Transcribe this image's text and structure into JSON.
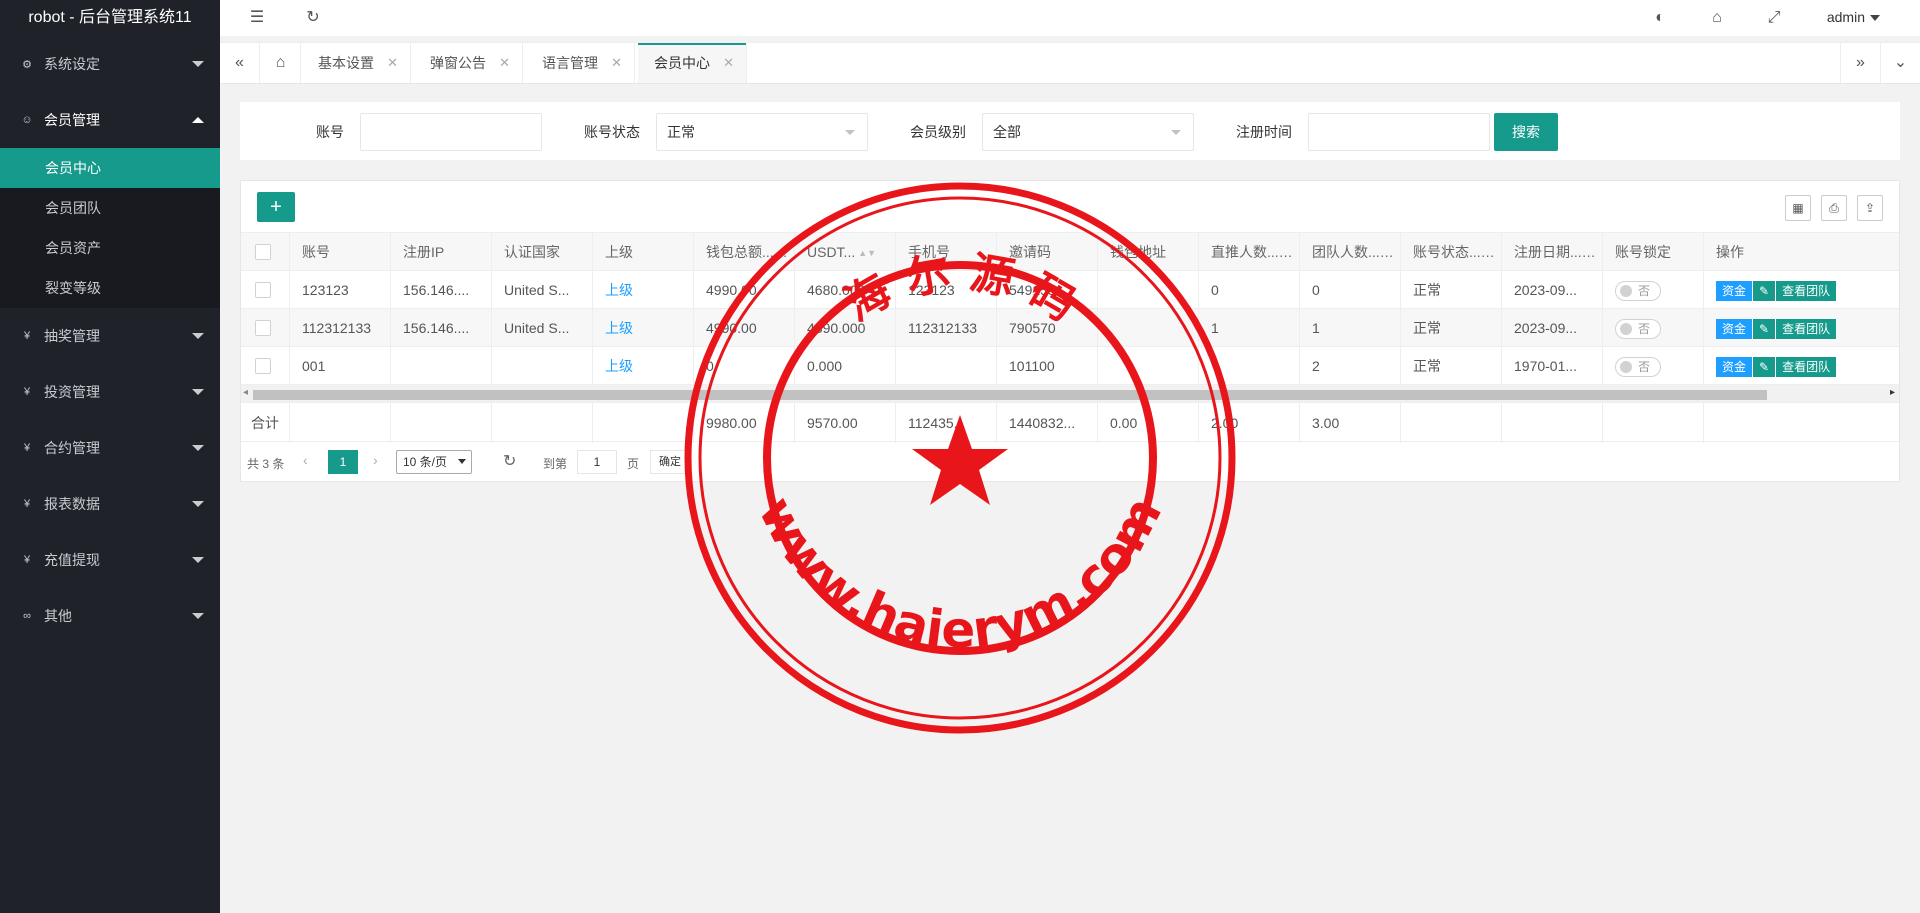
{
  "app": {
    "title": "robot - 后台管理系统11"
  },
  "sidebar": {
    "groups": [
      {
        "label": "系统设定",
        "icon": "gear-icon"
      },
      {
        "label": "会员管理",
        "icon": "user-icon",
        "items": [
          "会员中心",
          "会员团队",
          "会员资产",
          "裂变等级"
        ]
      },
      {
        "label": "抽奖管理",
        "icon": "yen-icon"
      },
      {
        "label": "投资管理",
        "icon": "yen-icon"
      },
      {
        "label": "合约管理",
        "icon": "yen-icon"
      },
      {
        "label": "报表数据",
        "icon": "yen-icon"
      },
      {
        "label": "充值提现",
        "icon": "yen-icon"
      },
      {
        "label": "其他",
        "icon": "link-icon"
      }
    ],
    "active_item": "会员中心"
  },
  "header": {
    "user": "admin"
  },
  "tabs": [
    "基本设置",
    "弹窗公告",
    "语言管理",
    "会员中心"
  ],
  "search": {
    "account_label": "账号",
    "account_value": "",
    "status_label": "账号状态",
    "status_value": "正常",
    "level_label": "会员级别",
    "level_value": "全部",
    "regtime_label": "注册时间",
    "regtime_value": "",
    "button": "搜索"
  },
  "table": {
    "add_label": "+",
    "columns": [
      "账号",
      "注册IP",
      "认证国家",
      "上级",
      "钱包总额...",
      "USDT...",
      "手机号",
      "邀请码",
      "钱包地址",
      "直推人数...",
      "团队人数...",
      "账号状态...",
      "注册日期...",
      "账号锁定",
      "操作"
    ],
    "rows": [
      [
        "123123",
        "156.146....",
        "United S...",
        "上级",
        "4990.00",
        "4680.000",
        "123123",
        "549155",
        "",
        "0",
        "0",
        "正常",
        "2023-09...",
        "否"
      ],
      [
        "112312133",
        "156.146....",
        "United S...",
        "上级",
        "4990.00",
        "4890.000",
        "112312133",
        "790570",
        "",
        "1",
        "1",
        "正常",
        "2023-09...",
        "否"
      ],
      [
        "001",
        "",
        "",
        "上级",
        "0",
        "0.000",
        "",
        "101100",
        "",
        "",
        "2",
        "正常",
        "1970-01...",
        "否"
      ]
    ],
    "ops": [
      "资金",
      "查看团队"
    ],
    "total": {
      "label": "合计",
      "wallet": "9980.00",
      "usdt": "9570.00",
      "phone": "112435...",
      "invite": "1440832...",
      "address": "0.00",
      "direct": "2.00",
      "team": "3.00"
    }
  },
  "pager": {
    "total_text": "共 3 条",
    "current_page": "1",
    "page_size": "10 条/页",
    "goto_label": "到第",
    "goto_value": "1",
    "page_unit": "页",
    "confirm": "确定"
  },
  "watermark": {
    "top_text": "海 尔 源 码",
    "bottom_text": "www.haierym.com"
  },
  "colors": {
    "sidebar": "#20222a",
    "accent": "#159a8c",
    "link": "#1e9fff",
    "stamp": "#e8151b"
  }
}
